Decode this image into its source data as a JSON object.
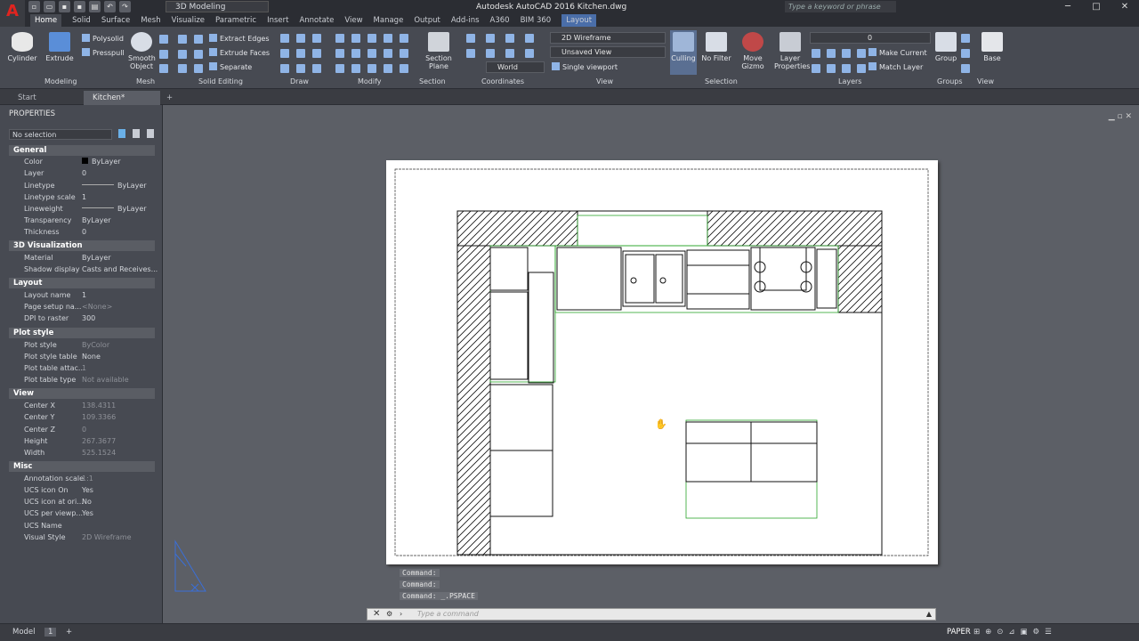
{
  "app": {
    "title": "Autodesk AutoCAD 2016    Kitchen.dwg",
    "logo": "A",
    "workspace": "3D Modeling",
    "search_placeholder": "Type a keyword or phrase"
  },
  "window_controls": [
    "─",
    "□",
    "✕"
  ],
  "ribbon_tabs": [
    "Home",
    "Solid",
    "Surface",
    "Mesh",
    "Visualize",
    "Parametric",
    "Insert",
    "Annotate",
    "View",
    "Manage",
    "Output",
    "Add-ins",
    "A360",
    "BIM 360",
    "Layout"
  ],
  "ribbon": {
    "modeling": {
      "title": "Modeling",
      "cylinder": "Cylinder",
      "extrude": "Extrude",
      "polysolid": "Polysolid",
      "presspull": "Presspull"
    },
    "mesh": {
      "title": "Mesh",
      "smooth_object": "Smooth Object"
    },
    "solid_editing": {
      "title": "Solid Editing",
      "extract_edges": "Extract Edges",
      "extrude_faces": "Extrude Faces",
      "separate": "Separate"
    },
    "draw": {
      "title": "Draw"
    },
    "modify": {
      "title": "Modify"
    },
    "section": {
      "title": "Section",
      "section_plane": "Section Plane"
    },
    "coordinates": {
      "title": "Coordinates",
      "world": "World"
    },
    "view": {
      "title": "View",
      "visual_style": "2D Wireframe",
      "saved_view": "Unsaved View",
      "viewport": "Single viewport"
    },
    "selection": {
      "title": "Selection",
      "culling": "Culling",
      "no_filter": "No Filter",
      "move_gizmo": "Move Gizmo"
    },
    "layers": {
      "title": "Layers",
      "layer_properties": "Layer Properties",
      "current_layer": "0",
      "make_current": "Make Current",
      "match_layer": "Match Layer"
    },
    "groups": {
      "title": "Groups",
      "group": "Group"
    },
    "view2": {
      "title": "View",
      "base": "Base"
    }
  },
  "doc_tabs": {
    "start": "Start",
    "kitchen": "Kitchen*",
    "add": "+"
  },
  "properties": {
    "title": "PROPERTIES",
    "selection": "No selection",
    "sections": [
      {
        "name": "General",
        "rows": [
          [
            "Color",
            "ByLayer"
          ],
          [
            "Layer",
            "0"
          ],
          [
            "Linetype",
            "ByLayer"
          ],
          [
            "Linetype scale",
            "1"
          ],
          [
            "Lineweight",
            "ByLayer"
          ],
          [
            "Transparency",
            "ByLayer"
          ],
          [
            "Thickness",
            "0"
          ]
        ]
      },
      {
        "name": "3D Visualization",
        "rows": [
          [
            "Material",
            "ByLayer"
          ],
          [
            "Shadow display",
            "Casts and Receives..."
          ]
        ]
      },
      {
        "name": "Layout",
        "rows": [
          [
            "Layout name",
            "1"
          ],
          [
            "Page setup na...",
            "<None>"
          ],
          [
            "DPI to raster",
            "300"
          ]
        ]
      },
      {
        "name": "Plot style",
        "rows": [
          [
            "Plot style",
            "ByColor"
          ],
          [
            "Plot style table",
            "None"
          ],
          [
            "Plot table attac...",
            "1"
          ],
          [
            "Plot table type",
            "Not available"
          ]
        ]
      },
      {
        "name": "View",
        "rows": [
          [
            "Center X",
            "138.4311"
          ],
          [
            "Center Y",
            "109.3366"
          ],
          [
            "Center Z",
            "0"
          ],
          [
            "Height",
            "267.3677"
          ],
          [
            "Width",
            "525.1524"
          ]
        ]
      },
      {
        "name": "Misc",
        "rows": [
          [
            "Annotation scale",
            "1:1"
          ],
          [
            "UCS icon On",
            "Yes"
          ],
          [
            "UCS icon at ori...",
            "No"
          ],
          [
            "UCS per viewp...",
            "Yes"
          ],
          [
            "UCS Name",
            ""
          ],
          [
            "Visual Style",
            "2D Wireframe"
          ]
        ]
      }
    ]
  },
  "command": {
    "history": [
      "Command:",
      "Command:",
      "Command:  _.PSPACE"
    ],
    "placeholder": "Type a command"
  },
  "status": {
    "model_tab": "Model",
    "layout_tab": "1",
    "space": "PAPER"
  }
}
